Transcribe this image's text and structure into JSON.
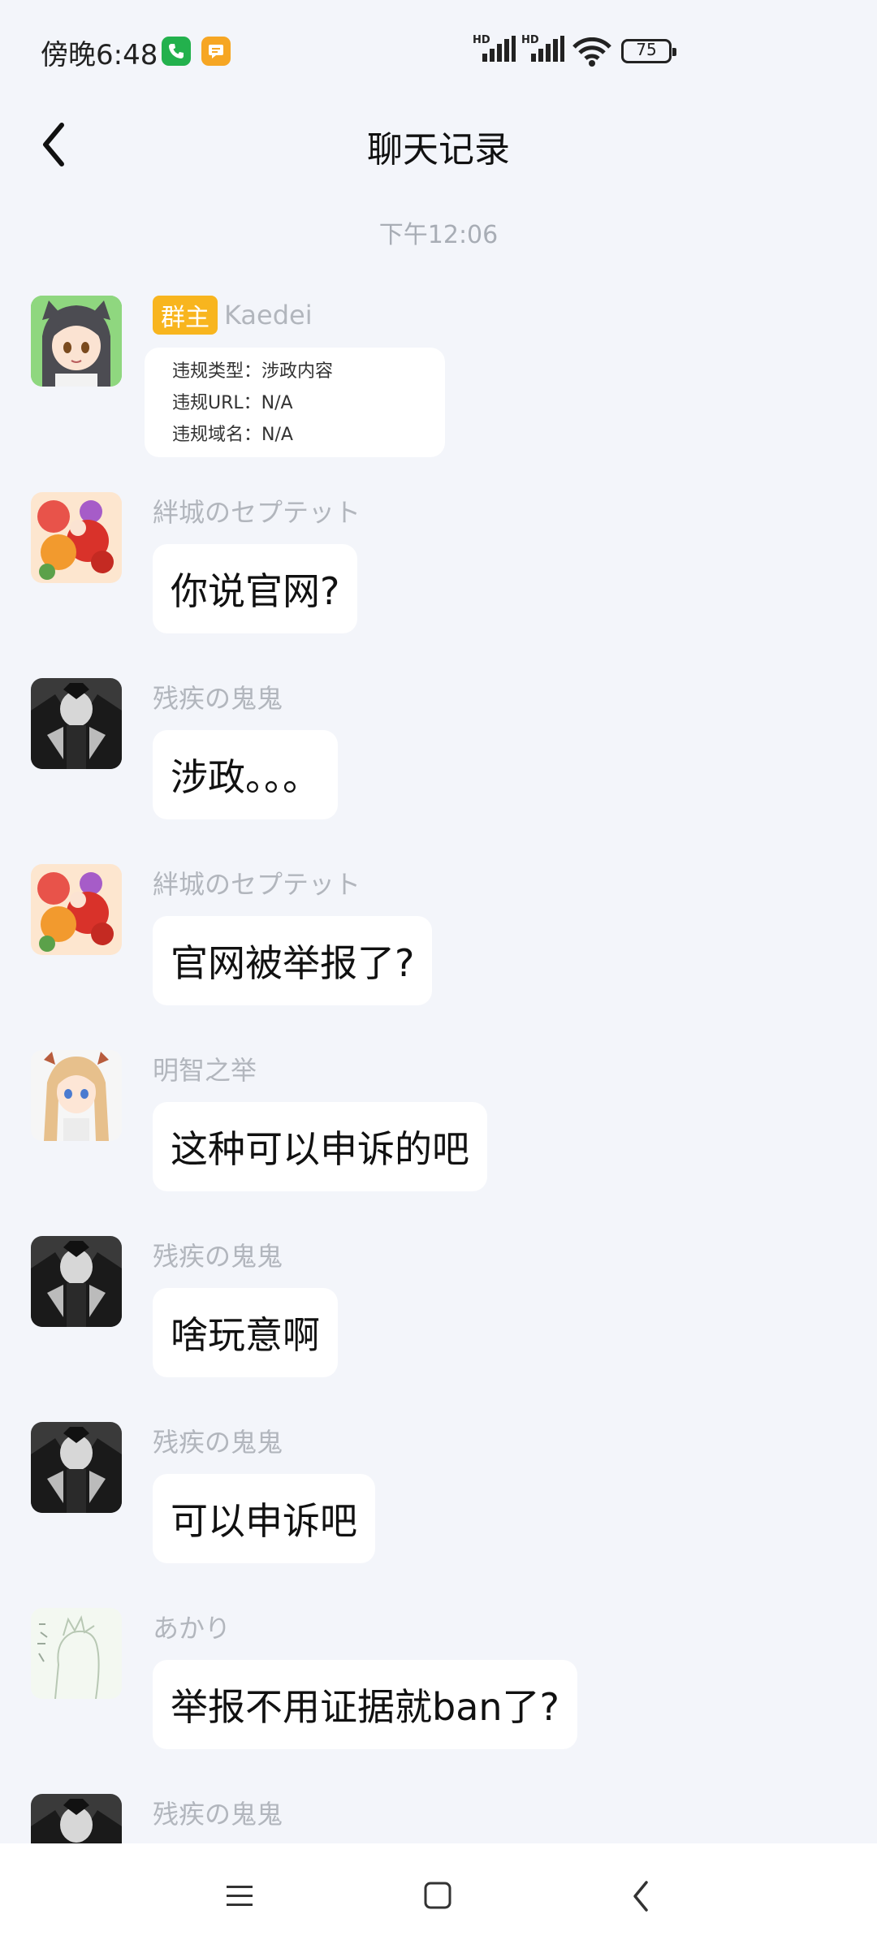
{
  "status_bar": {
    "time": "傍晚6:48",
    "signal_label": "HD",
    "battery": "75"
  },
  "header": {
    "title": "聊天记录"
  },
  "chat": {
    "time_divider": "下午12:06",
    "messages": [
      {
        "sender": "Kaedei",
        "role_badge": "群主",
        "card": {
          "line1": "违规类型：涉政内容",
          "line2": "违规URL：N/A",
          "line3": "违规域名：N/A"
        }
      },
      {
        "sender": "絆城のセプテット",
        "text": "你说官网?"
      },
      {
        "sender": "残疾の鬼鬼",
        "text": "涉政。。。"
      },
      {
        "sender": "絆城のセプテット",
        "text": "官网被举报了?"
      },
      {
        "sender": "明智之举",
        "text": "这种可以申诉的吧"
      },
      {
        "sender": "残疾の鬼鬼",
        "text": "啥玩意啊"
      },
      {
        "sender": "残疾の鬼鬼",
        "text": "可以申诉吧"
      },
      {
        "sender": "あかり",
        "text": "举报不用证据就ban了?"
      },
      {
        "sender": "残疾の鬼鬼",
        "text": ""
      }
    ]
  },
  "colors": {
    "background": "#f3f5fa",
    "bubble": "#ffffff",
    "owner_badge": "#f8b51e",
    "sender_name": "#b2b6bd"
  }
}
